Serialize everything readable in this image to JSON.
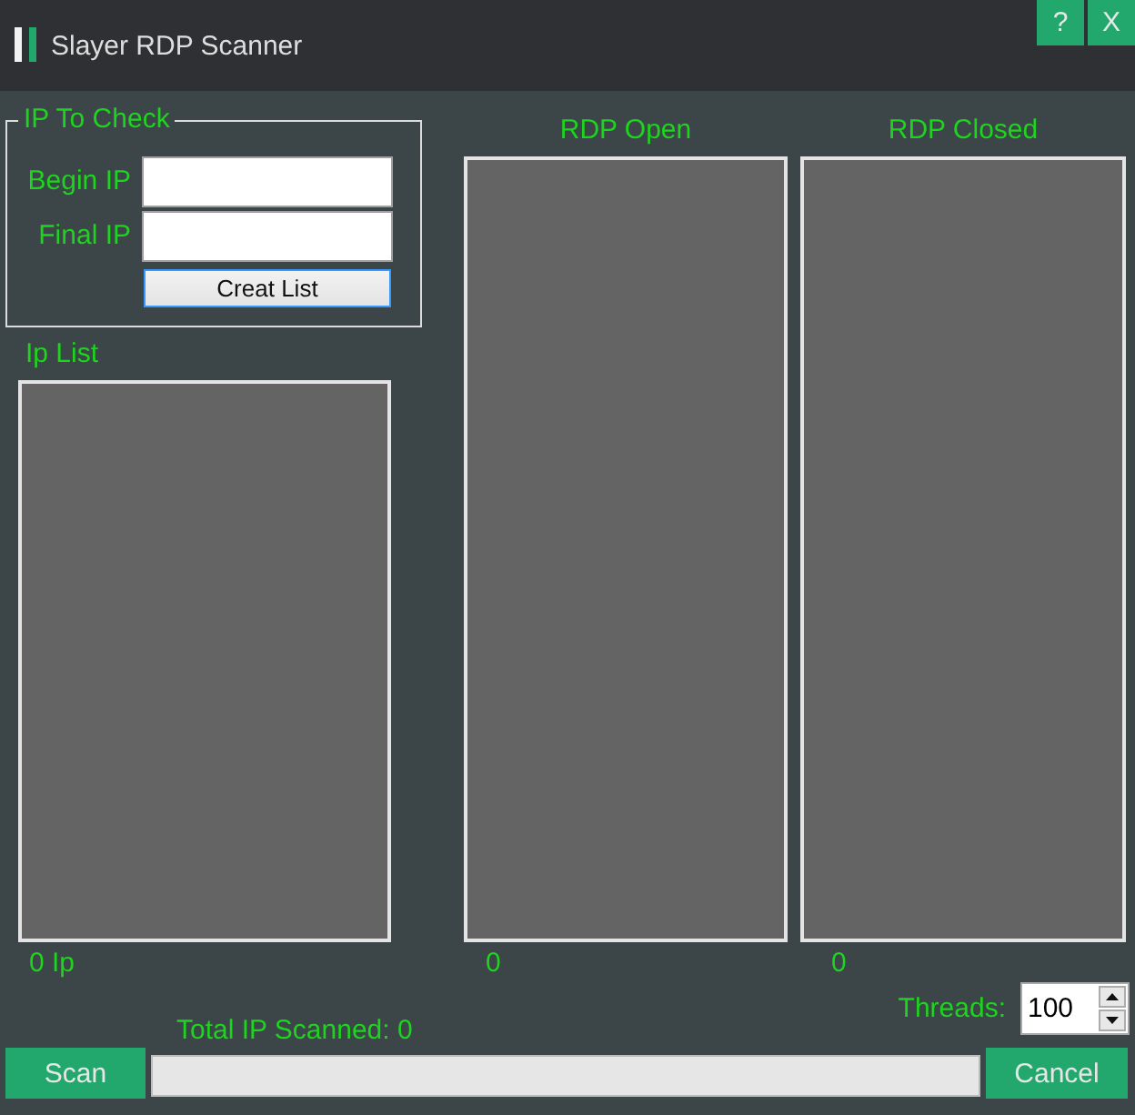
{
  "window": {
    "title": "Slayer RDP Scanner",
    "help_button": "?",
    "close_button": "X"
  },
  "ip_to_check": {
    "title": "IP To Check",
    "fields": [
      {
        "label": "Begin IP"
      },
      {
        "label": "Final IP"
      }
    ],
    "creat_list_button": "Creat List"
  },
  "ip_list": {
    "title": "Ip List",
    "count": "0 Ip"
  },
  "rdp_open": {
    "title": "RDP Open",
    "count": "0"
  },
  "rdp_closed": {
    "title": "RDP Closed",
    "count": "0"
  },
  "threads": {
    "label": "Threads:",
    "value": "100"
  },
  "total_scanned": "Total IP Scanned: 0",
  "progress": {
    "level": 0
  },
  "scan_button": "Scan",
  "cancel_button": "Cancel"
}
